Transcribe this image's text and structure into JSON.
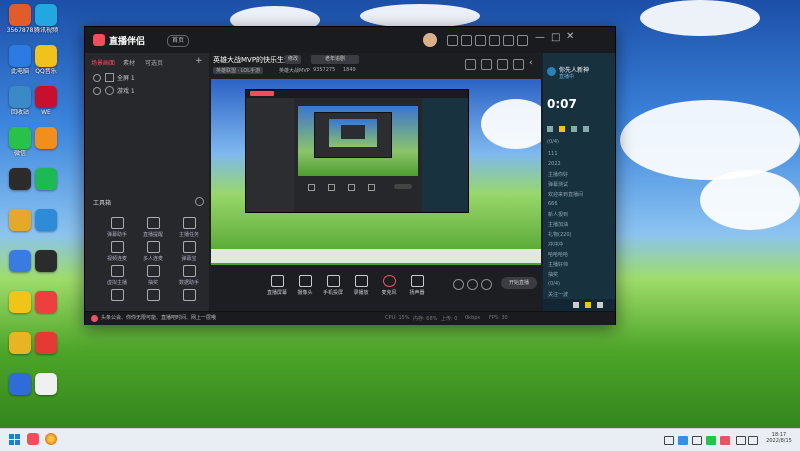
{
  "desktop": {
    "icons": [
      {
        "label": "3567878",
        "color": "#e25b2b"
      },
      {
        "label": "此电脑",
        "color": "#2b7be2"
      },
      {
        "label": "回收站",
        "color": "#3b89c7"
      },
      {
        "label": "微信",
        "color": "#2ac14a"
      },
      {
        "label": "",
        "color": "#2b2b2b"
      },
      {
        "label": "",
        "color": "#e6a82a"
      },
      {
        "label": "",
        "color": "#3a7be0"
      },
      {
        "label": "",
        "color": "#f0c419"
      },
      {
        "label": "",
        "color": "#e8b422"
      },
      {
        "label": "",
        "color": "#2f6cd8"
      },
      {
        "label": "腾讯视频",
        "color": "#22a7e0"
      },
      {
        "label": "QQ音乐",
        "color": "#f1c11c"
      },
      {
        "label": "WE",
        "color": "#c8102e"
      },
      {
        "label": "",
        "color": "#f28f1c"
      },
      {
        "label": "",
        "color": "#1db954"
      },
      {
        "label": "",
        "color": "#2e8bd8"
      },
      {
        "label": "",
        "color": "#2b2b2b"
      },
      {
        "label": "",
        "color": "#ee3f3f"
      },
      {
        "label": "",
        "color": "#e53935"
      },
      {
        "label": "",
        "color": "#f0f0f0"
      }
    ]
  },
  "app": {
    "brand": "直播伴侣",
    "brand_tag": "首页",
    "stream_title": "英雄大战MVP的快乐生活",
    "title_tag": "修改",
    "category": "老年追剧",
    "sub_info": [
      "英雄联盟 · LOL手游",
      "英雄大战MVP",
      "9357275",
      "1849"
    ],
    "scene_tabs": [
      "场景画面",
      "素材",
      "可选页"
    ],
    "scene_items": [
      "全屏 1",
      "游戏 1"
    ],
    "toolbox_title": "工具箱",
    "tools": [
      "弹幕助手",
      "直播提醒",
      "主播任务",
      "视频连麦",
      "多人连麦",
      "弹幕宝",
      "虚拟主播",
      "抽奖",
      "数据助手",
      "",
      "",
      ""
    ],
    "bottom_tools": [
      "直播屏幕",
      "摄像头",
      "手机投屏",
      "录播放",
      "麦克风",
      "扬声器"
    ],
    "start_button": "开始直播",
    "status_text": "头条公会、你你无限可能、直播吧时间、网上一层哦",
    "status_right": [
      "CPU: 15%",
      "内存: 68%",
      "上传: 0",
      "0kbps",
      "FPS: 30"
    ]
  },
  "chat": {
    "time": "0:07",
    "user": "你先人新神",
    "user_sub": "直播中",
    "counter": "(0/4)",
    "lines": [
      "111",
      "2022",
      "主播你好",
      "弹幕测试",
      "欢迎来到直播间",
      "666",
      "新人报到",
      "主播加油",
      "礼物(220)",
      "冲冲冲",
      "哈哈哈哈",
      "主播好帅",
      "抽奖",
      "(0/4)",
      "关注一波"
    ]
  },
  "taskbar": {
    "time": "18:17",
    "date": "2022/8/15"
  }
}
